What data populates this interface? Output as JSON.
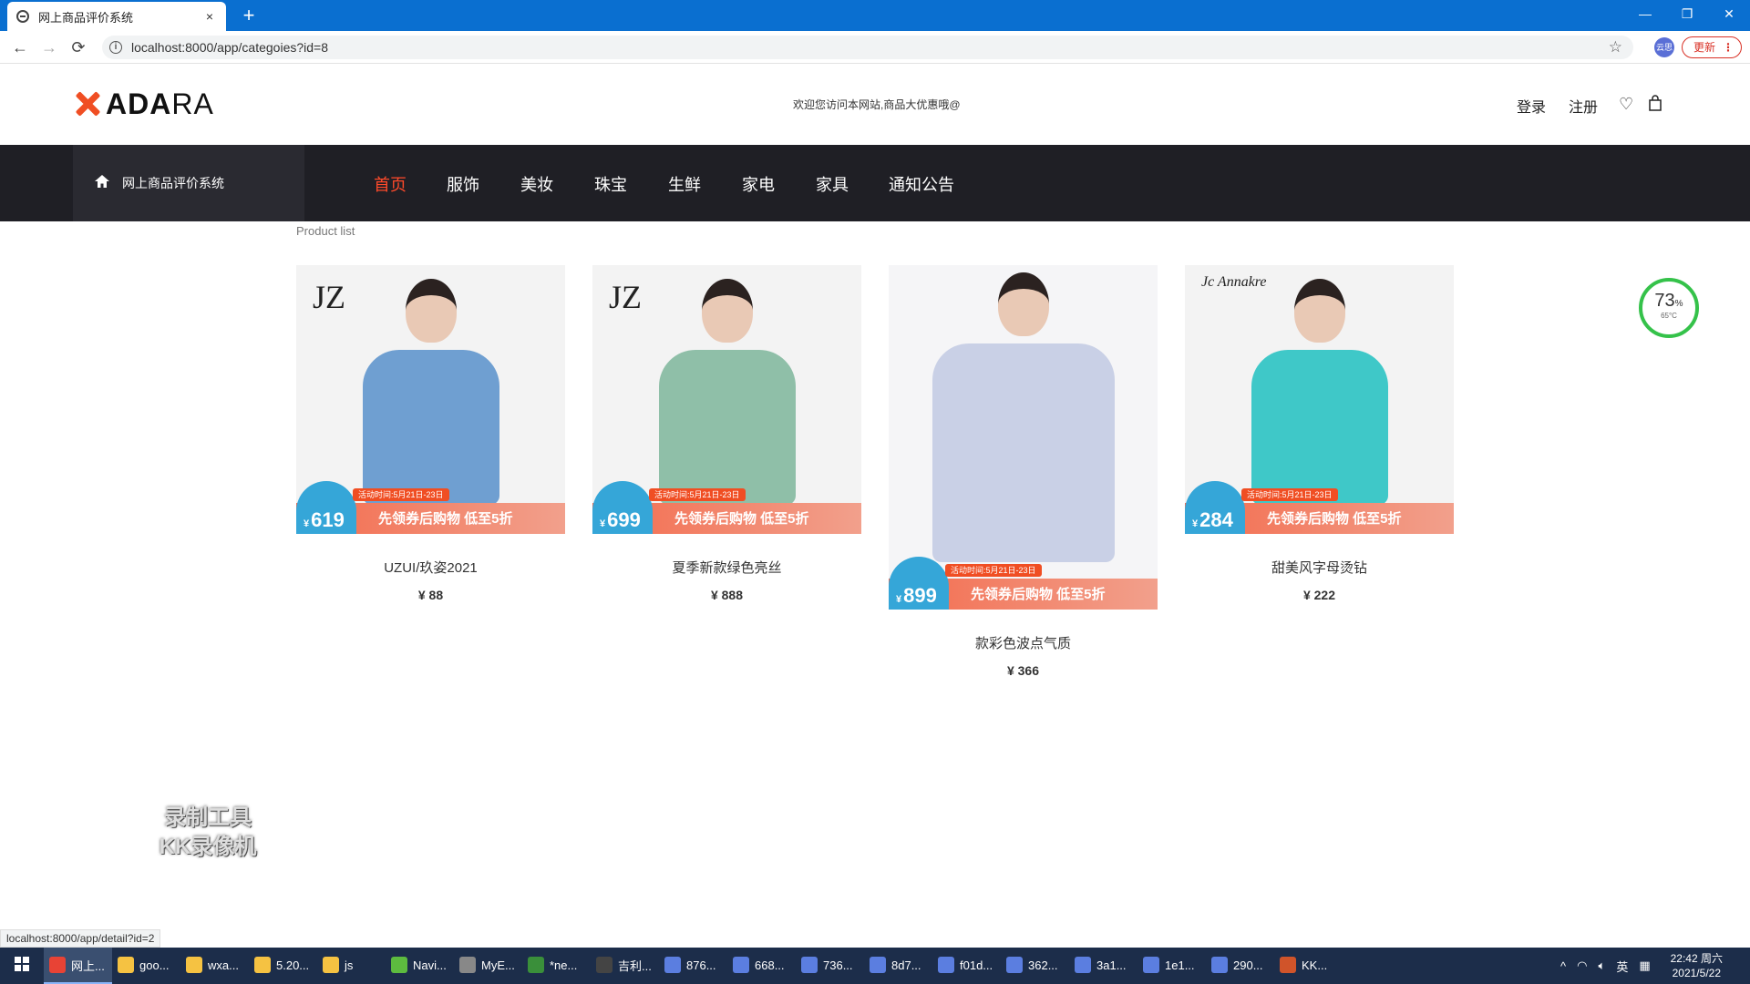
{
  "browser": {
    "tab_title": "网上商品评价系统",
    "tab_close": "×",
    "new_tab": "+",
    "url": "localhost:8000/app/categoies?id=8",
    "back": "←",
    "forward": "→",
    "reload": "⟳",
    "star": "☆",
    "update_label": "更新",
    "profile_label": "云思",
    "status_url": "localhost:8000/app/detail?id=2",
    "window_controls": [
      "—",
      "❐",
      "✕"
    ]
  },
  "header": {
    "logo_bold": "ADA",
    "logo_thin": "RA",
    "welcome": "欢迎您访问本网站,商品大优惠哦@",
    "login": "登录",
    "register": "注册"
  },
  "nav": {
    "home_label": "网上商品评价系统",
    "items": [
      "首页",
      "服饰",
      "美妆",
      "珠宝",
      "生鲜",
      "家电",
      "家具",
      "通知公告"
    ],
    "active_index": 0
  },
  "content": {
    "section_label": "Product list",
    "products": [
      {
        "name": "UZUI/玖姿2021",
        "price": "¥ 88",
        "brand": "JZ",
        "promo_price": "619",
        "promo_date": "活动时间:5月21日-23日",
        "promo_slogan": "先领券后购物 低至5折",
        "shirt_color": "#6f9fd1"
      },
      {
        "name": "夏季新款绿色亮丝",
        "price": "¥ 888",
        "brand": "JZ",
        "promo_price": "699",
        "promo_date": "活动时间:5月21日-23日",
        "promo_slogan": "先领券后购物 低至5折",
        "shirt_color": "#8fbfa8"
      },
      {
        "name": "款彩色波点气质",
        "price": "¥ 366",
        "brand": "",
        "promo_price": "899",
        "promo_date": "活动时间:5月21日-23日",
        "promo_slogan": "先领券后购物 低至5折",
        "shirt_color": "#c9d0e6"
      },
      {
        "name": "甜美风字母烫钻",
        "price": "¥ 222",
        "brand": "Jc Annakre",
        "promo_price": "284",
        "promo_date": "活动时间:5月21日-23日",
        "promo_slogan": "先领券后购物 低至5折",
        "shirt_color": "#3fc8c8"
      }
    ]
  },
  "overlay": {
    "gauge_pct": "73",
    "gauge_unit": "%",
    "gauge_temp": "65°C",
    "watermark_line1": "录制工具",
    "watermark_line2": "KK录像机"
  },
  "taskbar": {
    "items": [
      "网上...",
      "goo...",
      "wxa...",
      "5.20...",
      "js",
      "Navi...",
      "MyE...",
      "*ne...",
      "吉利...",
      "876...",
      "668...",
      "736...",
      "8d7...",
      "f01d...",
      "362...",
      "3a1...",
      "1e1...",
      "290...",
      "KK..."
    ],
    "active_index": 0,
    "lang": "英",
    "time": "22:42 周六",
    "date": "2021/5/22"
  }
}
